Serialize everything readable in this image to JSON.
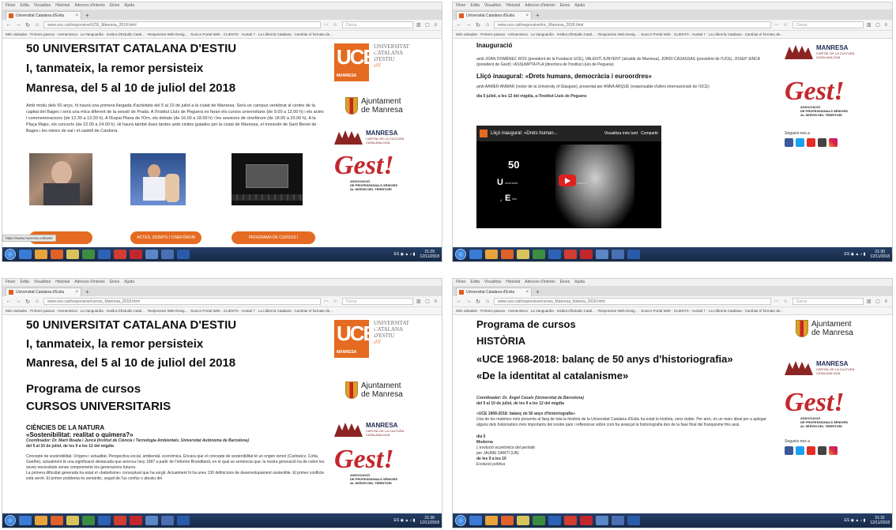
{
  "browser": {
    "menu": [
      "Fitxer",
      "Edita",
      "Visualitza",
      "Historial",
      "Adreces d'interès",
      "Eines",
      "Ajuda"
    ],
    "tab_title": "Universitat Catalana d'Estiu",
    "new_tab": "+",
    "close": "×",
    "url_pane1": "www.uce.cat/responsive/UCE_Manresa_2018.html",
    "url_pane2": "www.uce.cat/responsive/inc_Manresa_2018.html",
    "url_pane3": "www.uce.cat/responsive/cursos_Manresa_2018.html",
    "url_pane4": "www.uce.cat/responsive/cursos_Manresa_historia_2018.html",
    "search_placeholder": "Cerca",
    "bookmarks": "Més visitades · Primers passos · Hemeroteca · La Vanguardia · Institut d'Estudis Catal... · Responsive Web Desig... · Suscor Portal Web · CLIENTS · Avotati 7 · La Llibrería Catalana · Cambiar el formato de..."
  },
  "taskbar": {
    "time1": "21:29",
    "date1": "12/11/2018",
    "time2": "21:30",
    "date2": "12/11/2018",
    "time3": "21:30",
    "date3": "12/11/2018",
    "time4": "21:31",
    "date4": "12/11/2018"
  },
  "header": {
    "line1": "50 UNIVERSITAT CATALANA D'ESTIU",
    "line2": "I, tanmateix, la remor persisteix",
    "line3": "Manresa, del 5 al 10 de juliol del 2018"
  },
  "logos": {
    "uce_letters": "UCE",
    "uce_city": "MANRESA",
    "uce_text": [
      "UNIVERSITAT",
      "CATALANA",
      "D'ESTIU"
    ],
    "uce_lines": "////",
    "ajuntament": [
      "Ajuntament",
      "de Manresa"
    ],
    "manresa_title": "MANRESA",
    "manresa_sub": [
      "CAPITAL DE LA CULTURA",
      "CATALANA 2018"
    ],
    "gest": "Gest!",
    "gest_sub": [
      "ASSOCIACIÓ",
      "DE PROFESSIONALS SÈNIORS",
      "AL SERVEI DEL TERRITORI"
    ]
  },
  "pane1": {
    "intro": "Amb motiu dels 50 anys, hi haurà una primera llargada d'activitats del 5 al 10 de juliol a la ciutat de Manresa. Serà un campus vertebrat al centre de la capital del Bages i serà una mica diferent de la sessió de Prada. A l'Institut Lluís de Peguera es faran els cursos universitaris (de 9.00 a 12.00 h) i els actes i commemoracions (de 12.30 a 13.30 h). A l'Espai Plana de l'Om, els debats (de 16.00 a 18.00 h) i les sessions de cinefòrum (de 18.00 a 20.00 h). A la Plaça Major, els concerts (de 22.00 a 24.00 h). Hi haurà també dues tardes amb visites guiades per la ciutat de Manresa, el monestir de Sant Benet de Bages i les mines de sal i el castell de Cardona.",
    "btn_actes": "ACTES, DEBATS I CINEFÒRUM",
    "btn_programa": "PROGRAMA DE CURSOS I",
    "status_url": "https://www.manresa.cat/web/"
  },
  "pane2": {
    "title": "Inauguració",
    "intro": "amb JOAN DOMÈNEC ROS (president de la Fundació UCE), VALENTÍ JUNYENT (alcalde de Manresa), JORDI CASASSAS (president de l'UCE), JOSEP SINCA (president de Gest!) i ASSUMPTA PLA (directora de l'Institut Lluís de Peguera)",
    "lliço": "Lliçó inaugural: «Drets humans, democràcia i euroordres»",
    "by": "amb AAMER ANWAR (rector de la University of Glasgow), presentat per ANNA ARQUÉ (responsable d'afers internacionals de l'UCE)",
    "when": "dia 5 juliol, a les 12 del migdia, a l'Institut Lluís de Peguera",
    "video_title": "Lliçó inaugural: «Drets human...",
    "video_later": "Visualitza més tard",
    "video_share": "Compartir",
    "video_big": "50",
    "video_letters": [
      "U",
      "niversitat",
      "C",
      "atalana",
      "d'",
      "E",
      "stiu"
    ],
    "follow": "Segueix-nos a"
  },
  "pane3": {
    "program_title": "Programa de cursos",
    "program_sub": "CURSOS UNIVERSITARIS",
    "area": "CIÈNCIES DE LA NATURA",
    "course": "«Sostenibilitat: realitat o quimera?»",
    "coord": "Coordinador: Dr. Martí Boada i Juncà (Institut de Ciència i Tecnologia Ambientals, Universitat Autònoma de Barcelona)",
    "dates": "del 5 al 10 de juliol, de les 9 a les 12 del migdia",
    "p1": "Concepte de sostenibilitat. Orígens i actualitat. Perspectiva social, ambiental, econòmica. Encara que el concepte de sostenibilitat té un origen remot (Carlowicz, Cotta, Goethe), actualment té una significació destacada que arrenca l'any 1987 a partir de l'Informe Brundtland, en el qual se sentencia que: la nostra generació ha de cobrir les seves necessitats sense comprometre les generacions futures.",
    "p2": "La primera dificultat generada ha estat el «babelisme» conceptual que ha sorgit. Actualment hi ha unes 130 definicions de desenvolupament sostenible. El primer conflicte està servit. El primer problema és semàntic, seguit de l'us confús o abusiu del"
  },
  "pane4": {
    "program_title": "Programa de cursos",
    "subject": "HISTÒRIA",
    "course": "«UCE 1968-2018: balanç de 50 anys d'historiografia»",
    "course2": "«De la identitat al catalanisme»",
    "coord": "Coordinador: Dr. Àngel Casals (Universitat de Barcelona)",
    "dates": "del 5 al 10 de juliol, de les 9 a les 12 del migdia",
    "sub": "«UCE 1968-2018: balanç de 50 anys d'historiografia»",
    "p1": "Una de les matèries més presents al llarg de tota la història de la Universitat Catalana d'Estiu ha estat la història, sens dubte. Per això, és un marc ideal per a aplegar alguns dels historiadors més importants del nostre país i reflexionar sobre com ha avançat la historiografia des de la fase final del franquisme fins avui.",
    "day": "dia 5",
    "period": "Moderna",
    "topic": "L'evolució econòmica del període",
    "by": "per JAUME DANTÍ (UB)",
    "time": "de les 9 a les 10",
    "topic2": "Evolució política",
    "follow": "Segueix-nos a"
  }
}
